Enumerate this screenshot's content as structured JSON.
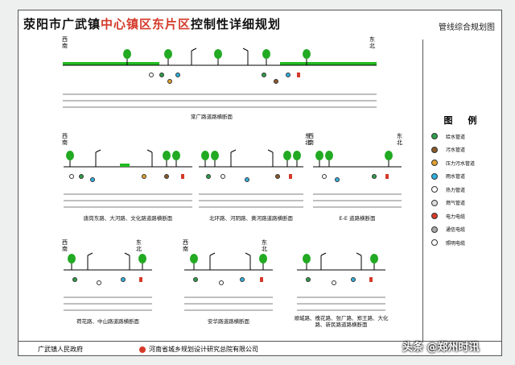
{
  "header": {
    "title_part1": "荥阳市广武镇",
    "title_part2": "中心镇区东片区",
    "title_part3": "控制性详细规划",
    "sheet_name": "管线综合规划图"
  },
  "legend": {
    "title": "图　例",
    "items": [
      {
        "label": "给水管道",
        "color": "#2e9e4a"
      },
      {
        "label": "污水管道",
        "color": "#8a5a2a"
      },
      {
        "label": "压力污水管道",
        "color": "#e0a030"
      },
      {
        "label": "雨水管道",
        "color": "#30b0e0"
      },
      {
        "label": "热力管道",
        "color": "#ffffff"
      },
      {
        "label": "燃气管道",
        "color": "#dddddd"
      },
      {
        "label": "电力电缆",
        "color": "#d43a2a"
      },
      {
        "label": "通信电缆",
        "color": "#aaaaaa"
      },
      {
        "label": "照明电缆",
        "color": "#ffffff"
      }
    ]
  },
  "sections": [
    {
      "label": "棠广路道路横断面",
      "west": "西南",
      "east": "东北"
    },
    {
      "label": "唐岗东路、大河路、文化路道路横断面",
      "west": "西南",
      "east": ""
    },
    {
      "label": "北环路、河阴路、黄河路道路横断面",
      "west": "",
      "east": "东北"
    },
    {
      "label": "E-E 道路横断面",
      "west": "西南",
      "east": "东北"
    },
    {
      "label": "荷花路、中山路道路横断面",
      "west": "西南",
      "east": "东北"
    },
    {
      "label": "安华路道路横断面",
      "west": "西南",
      "east": "东北"
    },
    {
      "label": "顺城路、槐花路、张厂路、郑王路、大化路、新民路道路横断面",
      "west": "",
      "east": ""
    }
  ],
  "footer": {
    "left": "广武镇人民政府",
    "middle": "河南省城乡规划设计研究总院有限公司"
  },
  "watermark": "头条 @郑州时讯",
  "colors": {
    "tree": "#22aa22",
    "grass": "#22bb22",
    "title_red": "#d43a2a"
  }
}
